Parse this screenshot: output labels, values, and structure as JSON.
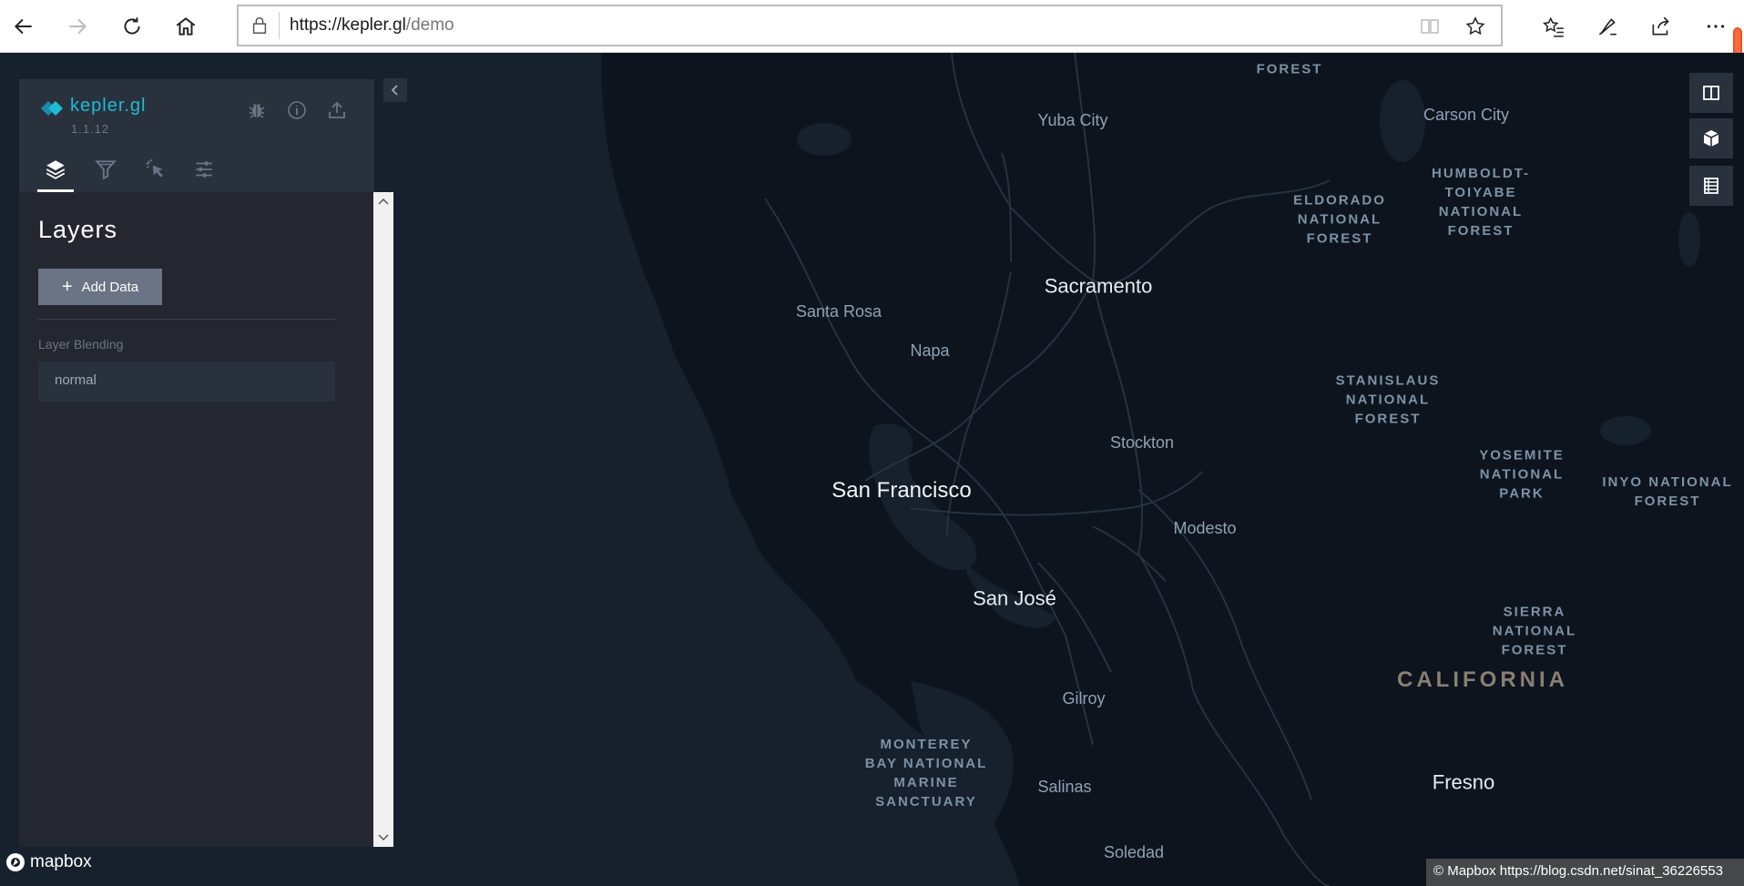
{
  "browser": {
    "url_host": "https://kepler.gl",
    "url_path": "/demo"
  },
  "app": {
    "name": "kepler.gl",
    "version": "1.1.12"
  },
  "panel": {
    "title": "Layers",
    "add_data_label": "Add Data",
    "blending_label": "Layer Blending",
    "blending_value": "normal"
  },
  "map": {
    "labels": [
      {
        "text": "FOREST",
        "kind": "park"
      },
      {
        "text": "Yuba City",
        "kind": "city"
      },
      {
        "text": "Carson City",
        "kind": "city"
      },
      {
        "text": "ELDORADO\nNATIONAL\nFOREST",
        "kind": "park"
      },
      {
        "text": "HUMBOLDT-\nTOIYABE\nNATIONAL\nFOREST",
        "kind": "park"
      },
      {
        "text": "Sacramento",
        "kind": "big"
      },
      {
        "text": "Santa Rosa",
        "kind": "city"
      },
      {
        "text": "Napa",
        "kind": "city"
      },
      {
        "text": "STANISLAUS\nNATIONAL\nFOREST",
        "kind": "park"
      },
      {
        "text": "Stockton",
        "kind": "city"
      },
      {
        "text": "YOSEMITE\nNATIONAL\nPARK",
        "kind": "park"
      },
      {
        "text": "INYO NATIONAL\nFOREST",
        "kind": "park"
      },
      {
        "text": "San Francisco",
        "kind": "huge"
      },
      {
        "text": "Modesto",
        "kind": "city"
      },
      {
        "text": "San José",
        "kind": "big"
      },
      {
        "text": "SIERRA\nNATIONAL\nFOREST",
        "kind": "park"
      },
      {
        "text": "CALIFORNIA",
        "kind": "state"
      },
      {
        "text": "Gilroy",
        "kind": "city"
      },
      {
        "text": "MONTEREY\nBAY NATIONAL\nMARINE\nSANCTUARY",
        "kind": "park"
      },
      {
        "text": "Salinas",
        "kind": "city"
      },
      {
        "text": "Fresno",
        "kind": "big"
      },
      {
        "text": "Soledad",
        "kind": "city"
      }
    ]
  },
  "footer": {
    "mapbox_text": "mapbox",
    "attribution": "© Mapbox https://blog.csdn.net/sinat_36226553"
  }
}
